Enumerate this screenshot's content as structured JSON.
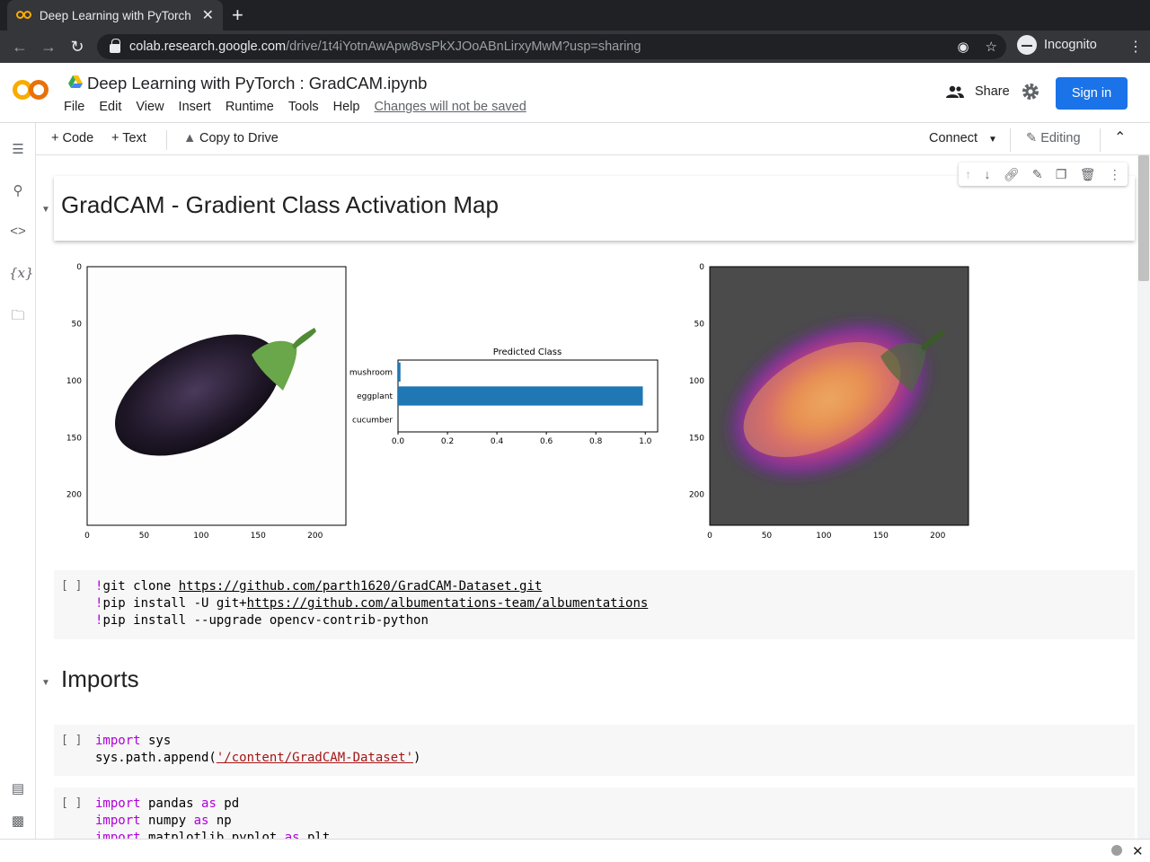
{
  "browser": {
    "tab_title": "Deep Learning with PyTorch",
    "tab_close": "✕",
    "new_tab": "+",
    "url_host": "colab.research.google.com",
    "url_path": "/drive/1t4iYotnAwApw8vsPkXJOoABnLirxyMwM?usp=sharing",
    "profile_label": "Incognito"
  },
  "header": {
    "notebook_title": "Deep Learning with PyTorch  : GradCAM.ipynb",
    "menu": [
      "File",
      "Edit",
      "View",
      "Insert",
      "Runtime",
      "Tools",
      "Help"
    ],
    "unsaved_note": "Changes will not be saved",
    "share_label": "Share",
    "signin_label": "Sign in"
  },
  "toolbar": {
    "add_code": "+ Code",
    "add_text": "+ Text",
    "copy_drive": "Copy to Drive",
    "connect": "Connect",
    "editing": "Editing"
  },
  "cells": {
    "heading1": "GradCAM - Gradient Class Activation Map",
    "heading2": "Imports",
    "run_bracket": "[ ]",
    "code1": {
      "line1_prefix": "!git clone ",
      "line1_link": "https://github.com/parth1620/GradCAM-Dataset.git",
      "line2_prefix": "!pip install -U git+",
      "line2_link": "https://github.com/albumentations-team/albumentations",
      "line3": "!pip install --upgrade opencv-contrib-python"
    },
    "code2": {
      "kw_import": "import",
      "module": " sys",
      "line2_pre": "sys.path.append(",
      "line2_str": "'/content/GradCAM-Dataset'",
      "line2_post": ")"
    },
    "code3": {
      "l1_kw": "import",
      "l1_mod": " pandas ",
      "l1_as": "as",
      "l1_alias": " pd",
      "l2_kw": "import",
      "l2_mod": " numpy ",
      "l2_as": "as",
      "l2_alias": " np",
      "l3_kw": "import",
      "l3_mod": " matplotlib.pyplot ",
      "l3_as": "as",
      "l3_alias": " plt"
    }
  },
  "image_axes": {
    "y_ticks": [
      "0",
      "50",
      "100",
      "150",
      "200"
    ],
    "x_ticks": [
      "0",
      "50",
      "100",
      "150",
      "200"
    ]
  },
  "chart_data": {
    "type": "bar",
    "orientation": "horizontal",
    "title": "Predicted Class",
    "categories": [
      "mushroom",
      "eggplant",
      "cucumber"
    ],
    "values": [
      0.01,
      0.99,
      0.0
    ],
    "xlim": [
      0,
      1.05
    ],
    "x_ticks": [
      "0.0",
      "0.2",
      "0.4",
      "0.6",
      "0.8",
      "1.0"
    ],
    "bar_color": "#1f77b4",
    "grid": false
  },
  "colors": {
    "accent": "#1a73e8",
    "colab_orange": "#f9ab00",
    "keyword": "#af00db",
    "string": "#a31515"
  }
}
